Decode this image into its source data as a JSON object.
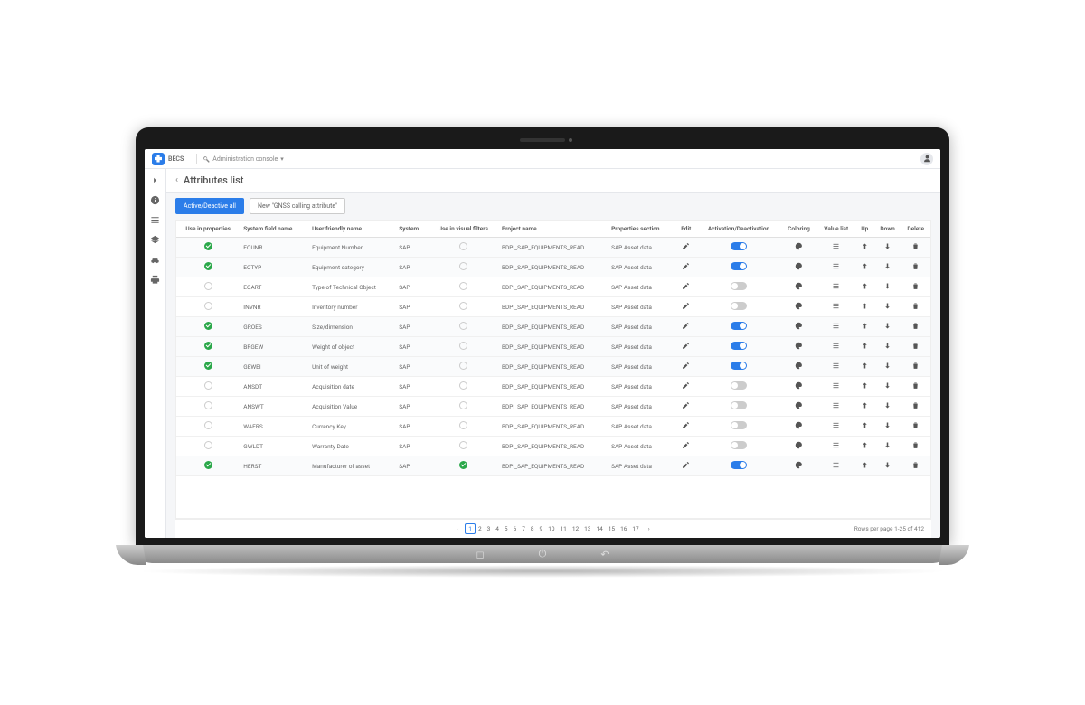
{
  "brand": "BECS",
  "breadcrumb": {
    "icon": "wrench",
    "label": "Administration console"
  },
  "page_title": "Attributes list",
  "buttons": {
    "active_all": "Active/Deactive all",
    "new_attr": "New \"GNSS calling attribute\""
  },
  "columns": [
    "Use in properties",
    "System field name",
    "User friendly name",
    "System",
    "Use in visual filters",
    "Project name",
    "Properties section",
    "Edit",
    "Activation/Deactivation",
    "Coloring",
    "Value list",
    "Up",
    "Down",
    "Delete"
  ],
  "rows": [
    {
      "use": true,
      "field": "EQUNR",
      "friendly": "Equipment Number",
      "system": "SAP",
      "vis": false,
      "project": "BDPI_SAP_EQUIPMENTS_READ",
      "section": "SAP Asset data",
      "active": true
    },
    {
      "use": true,
      "field": "EQTYP",
      "friendly": "Equipment category",
      "system": "SAP",
      "vis": false,
      "project": "BDPI_SAP_EQUIPMENTS_READ",
      "section": "SAP Asset data",
      "active": true
    },
    {
      "use": false,
      "field": "EQART",
      "friendly": "Type of Technical Object",
      "system": "SAP",
      "vis": false,
      "project": "BDPI_SAP_EQUIPMENTS_READ",
      "section": "SAP Asset data",
      "active": false
    },
    {
      "use": false,
      "field": "INVNR",
      "friendly": "Inventory number",
      "system": "SAP",
      "vis": false,
      "project": "BDPI_SAP_EQUIPMENTS_READ",
      "section": "SAP Asset data",
      "active": false
    },
    {
      "use": true,
      "field": "GROES",
      "friendly": "Size/dimension",
      "system": "SAP",
      "vis": false,
      "project": "BDPI_SAP_EQUIPMENTS_READ",
      "section": "SAP Asset data",
      "active": true
    },
    {
      "use": true,
      "field": "BRGEW",
      "friendly": "Weight of object",
      "system": "SAP",
      "vis": false,
      "project": "BDPI_SAP_EQUIPMENTS_READ",
      "section": "SAP Asset data",
      "active": true
    },
    {
      "use": true,
      "field": "GEWEI",
      "friendly": "Unit of weight",
      "system": "SAP",
      "vis": false,
      "project": "BDPI_SAP_EQUIPMENTS_READ",
      "section": "SAP Asset data",
      "active": true
    },
    {
      "use": false,
      "field": "ANSDT",
      "friendly": "Acquisition date",
      "system": "SAP",
      "vis": false,
      "project": "BDPI_SAP_EQUIPMENTS_READ",
      "section": "SAP Asset data",
      "active": false
    },
    {
      "use": false,
      "field": "ANSWT",
      "friendly": "Acquisition Value",
      "system": "SAP",
      "vis": false,
      "project": "BDPI_SAP_EQUIPMENTS_READ",
      "section": "SAP Asset data",
      "active": false
    },
    {
      "use": false,
      "field": "WAERS",
      "friendly": "Currency Key",
      "system": "SAP",
      "vis": false,
      "project": "BDPI_SAP_EQUIPMENTS_READ",
      "section": "SAP Asset data",
      "active": false
    },
    {
      "use": false,
      "field": "GWLDT",
      "friendly": "Warranty Date",
      "system": "SAP",
      "vis": false,
      "project": "BDPI_SAP_EQUIPMENTS_READ",
      "section": "SAP Asset data",
      "active": false
    },
    {
      "use": true,
      "field": "HERST",
      "friendly": "Manufacturer of asset",
      "system": "SAP",
      "vis": true,
      "project": "BDPI_SAP_EQUIPMENTS_READ",
      "section": "SAP Asset data",
      "active": true
    }
  ],
  "pagination": {
    "pages": [
      1,
      2,
      3,
      4,
      5,
      6,
      7,
      8,
      9,
      10,
      11,
      12,
      13,
      14,
      15,
      16,
      17
    ],
    "current": 1,
    "info": "Rows per page 1-25 of 412"
  }
}
